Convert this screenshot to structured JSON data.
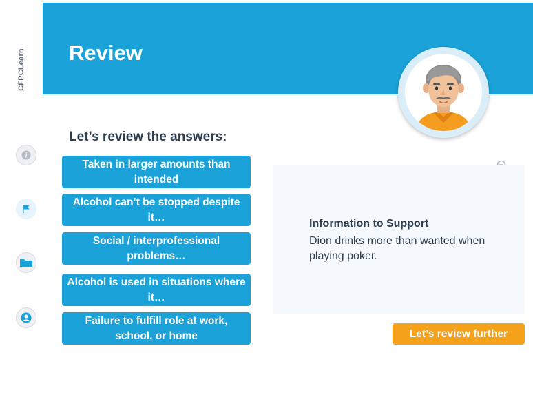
{
  "sidebar": {
    "brand": "CFPCLearn",
    "buttons": [
      {
        "icon": "info-icon"
      },
      {
        "icon": "flag-icon"
      },
      {
        "icon": "folder-icon"
      },
      {
        "icon": "user-icon"
      }
    ]
  },
  "header": {
    "title": "Review",
    "avatar_icon": "character-avatar",
    "color": "#1aa2d9"
  },
  "review": {
    "heading": "Let’s review the answers:",
    "answers": [
      "Taken in larger amounts than intended",
      "Alcohol can’t be stopped despite it…",
      "Social / interprofessional problems…",
      "Alcohol is used in situations where it…",
      "Failure to fulfill role at work, school, or home"
    ]
  },
  "info": {
    "title": "Information to Support",
    "body": "Dion drinks more than wanted when playing poker."
  },
  "actions": {
    "review_further": "Let’s review further",
    "button_color": "#f5a21a"
  }
}
